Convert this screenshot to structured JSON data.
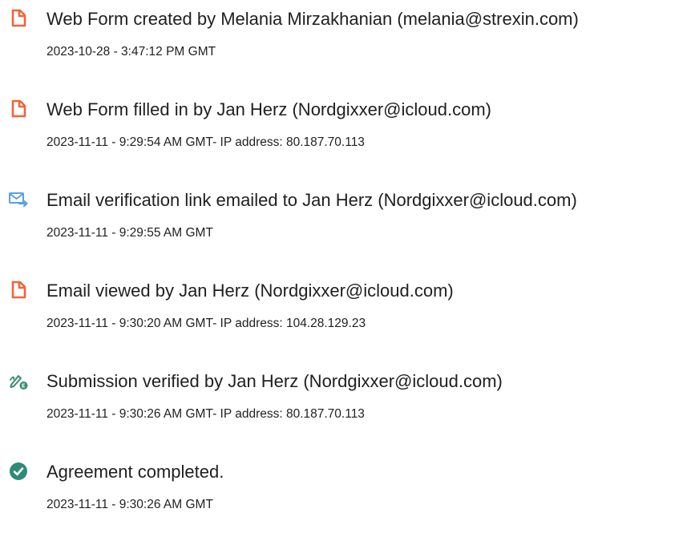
{
  "events": [
    {
      "icon": "document-icon",
      "title": "Web Form created by Melania Mirzakhanian (melania@strexin.com)",
      "meta": "2023-10-28 - 3:47:12 PM GMT"
    },
    {
      "icon": "document-icon",
      "title": "Web Form filled in by Jan Herz (Nordgixxer@icloud.com)",
      "meta": "2023-11-11 - 9:29:54 AM GMT- IP address: 80.187.70.113"
    },
    {
      "icon": "email-send-icon",
      "title": "Email verification link emailed to Jan Herz (Nordgixxer@icloud.com)",
      "meta": "2023-11-11 - 9:29:55 AM GMT"
    },
    {
      "icon": "document-icon",
      "title": "Email viewed by Jan Herz (Nordgixxer@icloud.com)",
      "meta": "2023-11-11 - 9:30:20 AM GMT- IP address: 104.28.129.23"
    },
    {
      "icon": "signature-verified-icon",
      "title": "Submission verified by Jan Herz (Nordgixxer@icloud.com)",
      "meta": "2023-11-11 - 9:30:26 AM GMT- IP address: 80.187.70.113"
    },
    {
      "icon": "check-circle-icon",
      "title": "Agreement completed.",
      "meta": "2023-11-11 - 9:30:26 AM GMT"
    }
  ],
  "colors": {
    "document_icon": "#f0643c",
    "email_icon": "#5aa0e0",
    "signature_icon": "#3a8d6e",
    "check_icon": "#2f8a78",
    "text": "#1f1f1f"
  }
}
